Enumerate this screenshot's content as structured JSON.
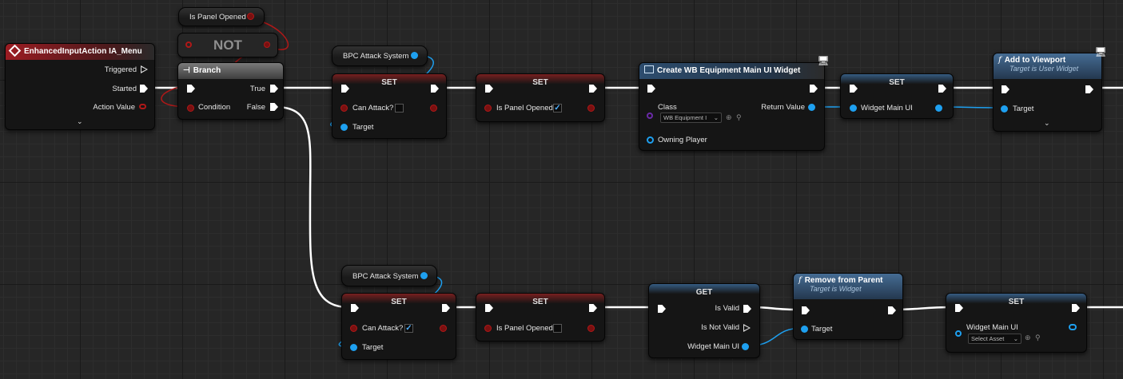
{
  "theme": {
    "exec_wire": "#ffffff",
    "object_wire": "#1ea0f0",
    "bool_wire": "#b01818",
    "event_header": "#9b1c22",
    "function_header": "#456c93"
  },
  "nodes": {
    "event": {
      "title": "EnhancedInputAction IA_Menu",
      "pins": {
        "triggered": "Triggered",
        "started": "Started",
        "action_value": "Action Value"
      },
      "expand_icon": "chevron-down-icon"
    },
    "is_panel_opened_getter": {
      "label": "Is Panel Opened"
    },
    "not_node": {
      "label": "NOT"
    },
    "branch": {
      "title": "Branch",
      "pins": {
        "condition": "Condition",
        "true": "True",
        "false": "False"
      }
    },
    "bpc_getter_top": {
      "label": "BPC Attack System"
    },
    "bpc_getter_bottom": {
      "label": "BPC Attack System"
    },
    "set_can_attack_top": {
      "title": "SET",
      "pins": {
        "can_attack": "Can Attack?",
        "target": "Target"
      },
      "checked": false
    },
    "set_panel_top": {
      "title": "SET",
      "pins": {
        "is_panel_opened": "Is Panel Opened"
      },
      "checked": true
    },
    "create_widget": {
      "title": "Create WB Equipment Main UI Widget",
      "pins": {
        "class": "Class",
        "return_value": "Return Value",
        "owning_player": "Owning Player"
      },
      "class_value": "WB Equipment I"
    },
    "set_widget_main_ui": {
      "title": "SET",
      "pins": {
        "widget_main_ui": "Widget Main UI"
      }
    },
    "add_to_viewport": {
      "title": "Add to Viewport",
      "subtitle": "Target is User Widget",
      "pins": {
        "target": "Target"
      },
      "expand_icon": "chevron-down-icon"
    },
    "set_can_attack_bottom": {
      "title": "SET",
      "pins": {
        "can_attack": "Can Attack?",
        "target": "Target"
      },
      "checked": true
    },
    "set_panel_bottom": {
      "title": "SET",
      "pins": {
        "is_panel_opened": "Is Panel Opened"
      },
      "checked": false
    },
    "get_validated": {
      "title": "GET",
      "pins": {
        "is_valid": "Is Valid",
        "is_not_valid": "Is Not Valid",
        "widget_main_ui": "Widget Main UI"
      }
    },
    "remove_from_parent": {
      "title": "Remove from Parent",
      "subtitle": "Target is Widget",
      "pins": {
        "target": "Target"
      }
    },
    "set_widget_clear": {
      "title": "SET",
      "pins": {
        "widget_main_ui": "Widget Main UI"
      },
      "asset_value": "Select Asset"
    }
  }
}
